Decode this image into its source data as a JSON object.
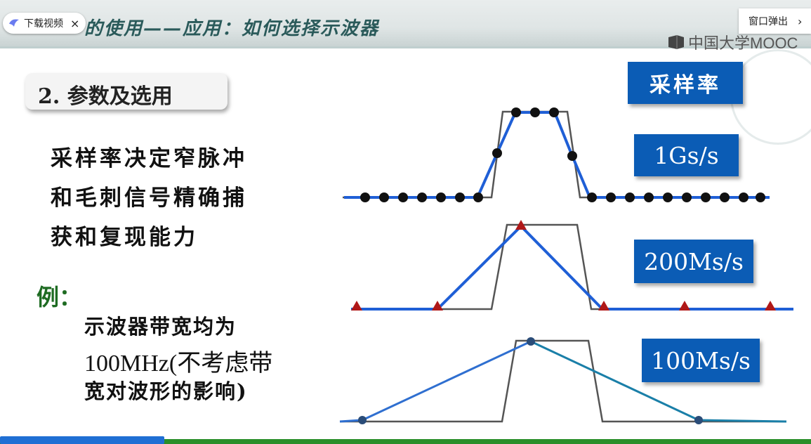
{
  "header": {
    "title": "的使用——应用：如何选择示波器",
    "download_pill": {
      "label": "下载视频",
      "close": "×"
    },
    "popout": {
      "label": "窗口弹出",
      "chevron": "›"
    },
    "brand": "中国大学MOOC"
  },
  "slide": {
    "section_title": "2. 参数及选用",
    "paragraph_lines": [
      "采样率决定窄脉冲",
      "和毛刺信号精确捕",
      "获和复现能力"
    ],
    "example_label": "例：",
    "example_lines": [
      "示波器带宽均为",
      "100MHz(不考虑带",
      "宽对波形的影响)"
    ],
    "labels": {
      "sampling_rate": "采样率",
      "rate_1": "1Gs/s",
      "rate_2": "200Ms/s",
      "rate_3": "100Ms/s"
    }
  },
  "colors": {
    "accent_blue": "#0b5cb5",
    "trace_blue": "#1f5fd6",
    "trace_teal": "#1a7fa8",
    "marker_red": "#b01818",
    "example_green": "#1e6b22",
    "progress_green": "#2a8f2a"
  },
  "icons": [
    "bird-icon",
    "close-icon",
    "chevron-right-icon",
    "mooc-logo-icon"
  ]
}
